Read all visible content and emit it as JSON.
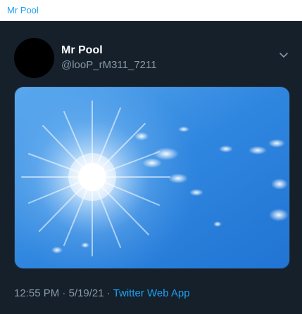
{
  "window": {
    "title": "Mr Pool"
  },
  "tweet": {
    "display_name": "Mr Pool",
    "handle": "@looP_rM311_7211",
    "time": "12:55 PM",
    "separator": " · ",
    "date": "5/19/21",
    "source": "Twitter Web App"
  },
  "icons": {
    "menu": "chevron-down-icon"
  },
  "colors": {
    "background": "#15202b",
    "accent": "#1da1f2",
    "secondary_text": "#8899a6",
    "primary_text": "#ffffff"
  }
}
